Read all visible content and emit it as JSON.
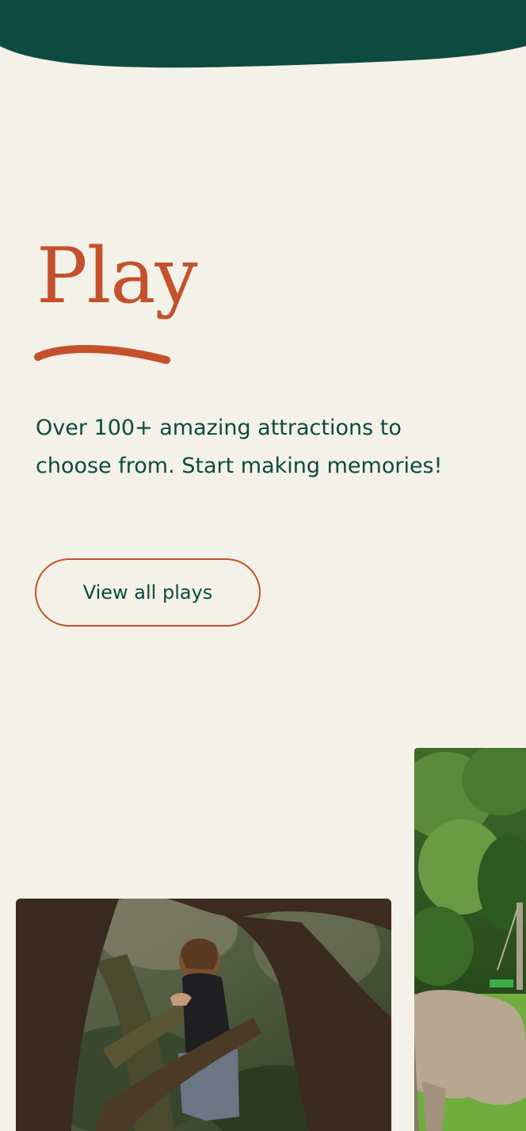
{
  "colors": {
    "background": "#f4f1e8",
    "header_green": "#0d4a3f",
    "accent_orange": "#c4512c",
    "text_green": "#0d4a3f"
  },
  "hero": {
    "title": "Play",
    "description": "Over 100+ amazing attractions to choose from. Start making memories!",
    "cta_label": "View all plays"
  },
  "gallery": {
    "images": [
      {
        "subject": "child climbing among trees in woodland"
      },
      {
        "subject": "pony grazing in a green field"
      }
    ]
  }
}
